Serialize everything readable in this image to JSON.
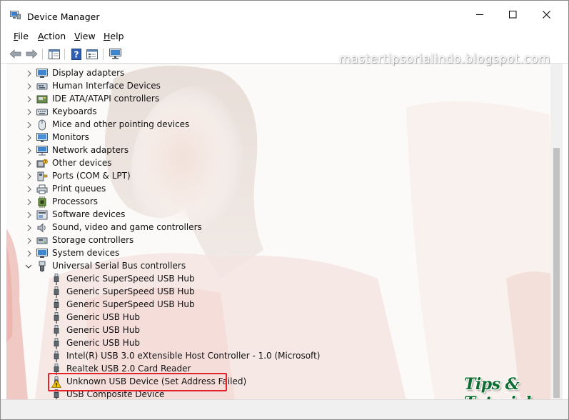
{
  "window": {
    "title": "Device Manager",
    "controls": {
      "minimize": "minimize",
      "maximize": "maximize",
      "close": "close"
    }
  },
  "menu": {
    "file": {
      "ul": "F",
      "rest": "ile"
    },
    "action": {
      "ul": "A",
      "rest": "ction"
    },
    "view": {
      "ul": "V",
      "rest": "iew"
    },
    "help": {
      "ul": "H",
      "rest": "elp"
    }
  },
  "toolbar": {
    "icons": [
      "back-arrow-icon",
      "forward-arrow-icon",
      "show-hide-console-tree-icon",
      "help-icon",
      "properties-icon",
      "scan-hardware-monitor-icon"
    ]
  },
  "tree": {
    "categories": [
      {
        "label": "Display adapters",
        "icon": "display-adapter-icon"
      },
      {
        "label": "Human Interface Devices",
        "icon": "hid-icon"
      },
      {
        "label": "IDE ATA/ATAPI controllers",
        "icon": "ide-controller-icon"
      },
      {
        "label": "Keyboards",
        "icon": "keyboard-icon"
      },
      {
        "label": "Mice and other pointing devices",
        "icon": "mouse-icon"
      },
      {
        "label": "Monitors",
        "icon": "monitor-icon"
      },
      {
        "label": "Network adapters",
        "icon": "network-adapter-icon"
      },
      {
        "label": "Other devices",
        "icon": "other-devices-icon"
      },
      {
        "label": "Ports (COM & LPT)",
        "icon": "port-icon"
      },
      {
        "label": "Print queues",
        "icon": "printer-icon"
      },
      {
        "label": "Processors",
        "icon": "processor-icon"
      },
      {
        "label": "Software devices",
        "icon": "software-device-icon"
      },
      {
        "label": "Sound, video and game controllers",
        "icon": "speaker-icon"
      },
      {
        "label": "Storage controllers",
        "icon": "storage-controller-icon"
      },
      {
        "label": "System devices",
        "icon": "system-device-icon"
      },
      {
        "label": "Universal Serial Bus controllers",
        "icon": "usb-controller-icon",
        "expanded": true
      }
    ],
    "usb_children": [
      {
        "label": "Generic SuperSpeed USB Hub",
        "icon": "usb-plug-icon"
      },
      {
        "label": "Generic SuperSpeed USB Hub",
        "icon": "usb-plug-icon"
      },
      {
        "label": "Generic SuperSpeed USB Hub",
        "icon": "usb-plug-icon"
      },
      {
        "label": "Generic USB Hub",
        "icon": "usb-plug-icon"
      },
      {
        "label": "Generic USB Hub",
        "icon": "usb-plug-icon"
      },
      {
        "label": "Generic USB Hub",
        "icon": "usb-plug-icon"
      },
      {
        "label": "Intel(R) USB 3.0 eXtensible Host Controller - 1.0 (Microsoft)",
        "icon": "usb-plug-icon"
      },
      {
        "label": "Realtek USB 2.0 Card Reader",
        "icon": "usb-plug-icon"
      },
      {
        "label": "Unknown USB Device (Set Address Failed)",
        "icon": "warning-icon",
        "highlighted": true
      },
      {
        "label": "USB Composite Device",
        "icon": "usb-plug-icon"
      }
    ]
  },
  "overlay": {
    "watermark": "mastertipsorialindo.blogspot.com",
    "logo": "Tips & Tutorial"
  },
  "colors": {
    "highlight_border": "#e3232a",
    "warning_yellow": "#f5c400",
    "logo_green": "#0c6b2e"
  }
}
